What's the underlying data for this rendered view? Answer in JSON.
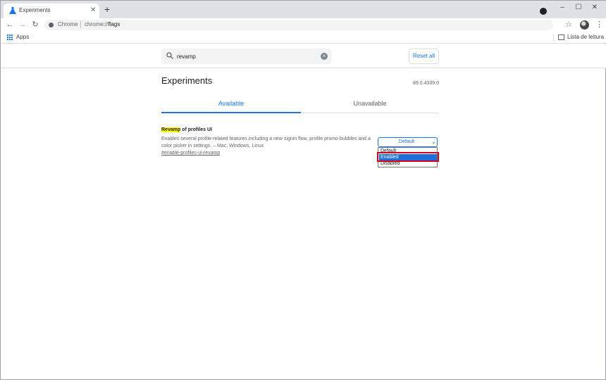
{
  "window": {
    "tab_title": "Experiments",
    "new_tab_symbol": "+",
    "controls": {
      "minimize": "–",
      "maximize": "☐",
      "close": "✕"
    }
  },
  "toolbar": {
    "site_chip": "Chrome",
    "url_scheme": "chrome://",
    "url_path": "flags"
  },
  "bookmarks": {
    "apps_label": "Apps",
    "reading_list_label": "Lista de leitura"
  },
  "search": {
    "value": "revamp",
    "reset_label": "Reset all"
  },
  "page": {
    "title": "Experiments",
    "version": "89.0.4339.0",
    "tabs": [
      {
        "label": "Available",
        "active": true
      },
      {
        "label": "Unavailable",
        "active": false
      }
    ]
  },
  "experiment": {
    "title_highlight": "Revamp",
    "title_rest": " of profiles UI",
    "description": "Enables several profile-related features including a new signin flow, profile promo bubbles and a color picker in settings. – Mac, Windows, Linux",
    "link": "#enable-profiles-ui-revamp",
    "select_value": "Default",
    "options": [
      "Default",
      "Enabled",
      "Disabled"
    ],
    "highlighted_option": "Enabled"
  },
  "colors": {
    "accent": "#1a73e8",
    "highlight": "#ffff00",
    "selected_option": "#1e6fd9",
    "annotation_box": "#d0021b"
  },
  "icons": [
    "chrome-flags-favicon",
    "close-icon",
    "plus-icon",
    "media-control-icon",
    "back-icon",
    "forward-icon",
    "reload-icon",
    "site-info-icon",
    "star-icon",
    "avatar",
    "menu-icon",
    "apps-icon",
    "reading-list-icon",
    "search-icon",
    "clear-icon",
    "chevron-down-icon"
  ]
}
